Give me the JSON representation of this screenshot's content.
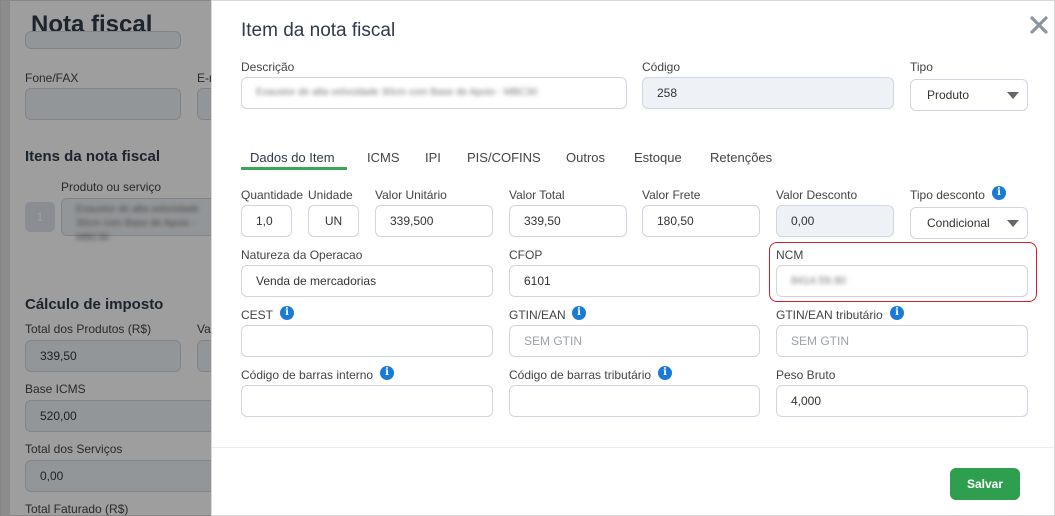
{
  "background": {
    "title": "Nota fiscal",
    "fone_label": "Fone/FAX",
    "email_label": "E-n",
    "itens_heading": "Itens da nota fiscal",
    "produto_label": "Produto ou serviço",
    "item_index": "1",
    "item_blurred": "Exaustor de alta velocidade 30cm com Base de Apoio - MBC30",
    "calculo_heading": "Cálculo de imposto",
    "total_produtos_label": "Total dos Produtos (R$)",
    "total_produtos_value": "339,50",
    "val_label": "Val",
    "base_icms_label": "Base ICMS",
    "base_icms_value": "520,00",
    "total_servicos_label": "Total dos Serviços",
    "total_servicos_value": "0,00",
    "total_faturado_label": "Total Faturado (R$)"
  },
  "modal": {
    "title": "Item da nota fiscal",
    "descricao_label": "Descrição",
    "descricao_value": "Exaustor de alta velocidade 30cm com Base de Apoio - MBC30",
    "codigo_label": "Código",
    "codigo_value": "258",
    "tipo_label": "Tipo",
    "tipo_value": "Produto",
    "tabs": [
      {
        "label": "Dados do Item"
      },
      {
        "label": "ICMS"
      },
      {
        "label": "IPI"
      },
      {
        "label": "PIS/COFINS"
      },
      {
        "label": "Outros"
      },
      {
        "label": "Estoque"
      },
      {
        "label": "Retenções"
      }
    ],
    "quantidade_label": "Quantidade",
    "quantidade_value": "1,0",
    "unidade_label": "Unidade",
    "unidade_value": "UN",
    "valor_unitario_label": "Valor Unitário",
    "valor_unitario_value": "339,500",
    "valor_total_label": "Valor Total",
    "valor_total_value": "339,50",
    "valor_frete_label": "Valor Frete",
    "valor_frete_value": "180,50",
    "valor_desconto_label": "Valor Desconto",
    "valor_desconto_value": "0,00",
    "tipo_desconto_label": "Tipo desconto",
    "tipo_desconto_value": "Condicional",
    "natureza_label": "Natureza da Operacao",
    "natureza_value": "Venda de mercadorias",
    "cfop_label": "CFOP",
    "cfop_value": "6101",
    "ncm_label": "NCM",
    "ncm_value": "8414.59.90",
    "cest_label": "CEST",
    "cest_value": "",
    "gtin_label": "GTIN/EAN",
    "gtin_placeholder": "SEM GTIN",
    "gtin_trib_label": "GTIN/EAN tributário",
    "gtin_trib_placeholder": "SEM GTIN",
    "cod_barras_interno_label": "Código de barras interno",
    "cod_barras_trib_label": "Código de barras tributário",
    "peso_bruto_label": "Peso Bruto",
    "peso_bruto_value": "4,000",
    "save_label": "Salvar",
    "info_glyph": "i",
    "close_icon": "close-icon"
  },
  "colors": {
    "accent_green": "#2e9e4f",
    "tab_underline": "#3aa65a",
    "highlight_red": "#d0202a",
    "info_blue": "#1a7bd6"
  }
}
